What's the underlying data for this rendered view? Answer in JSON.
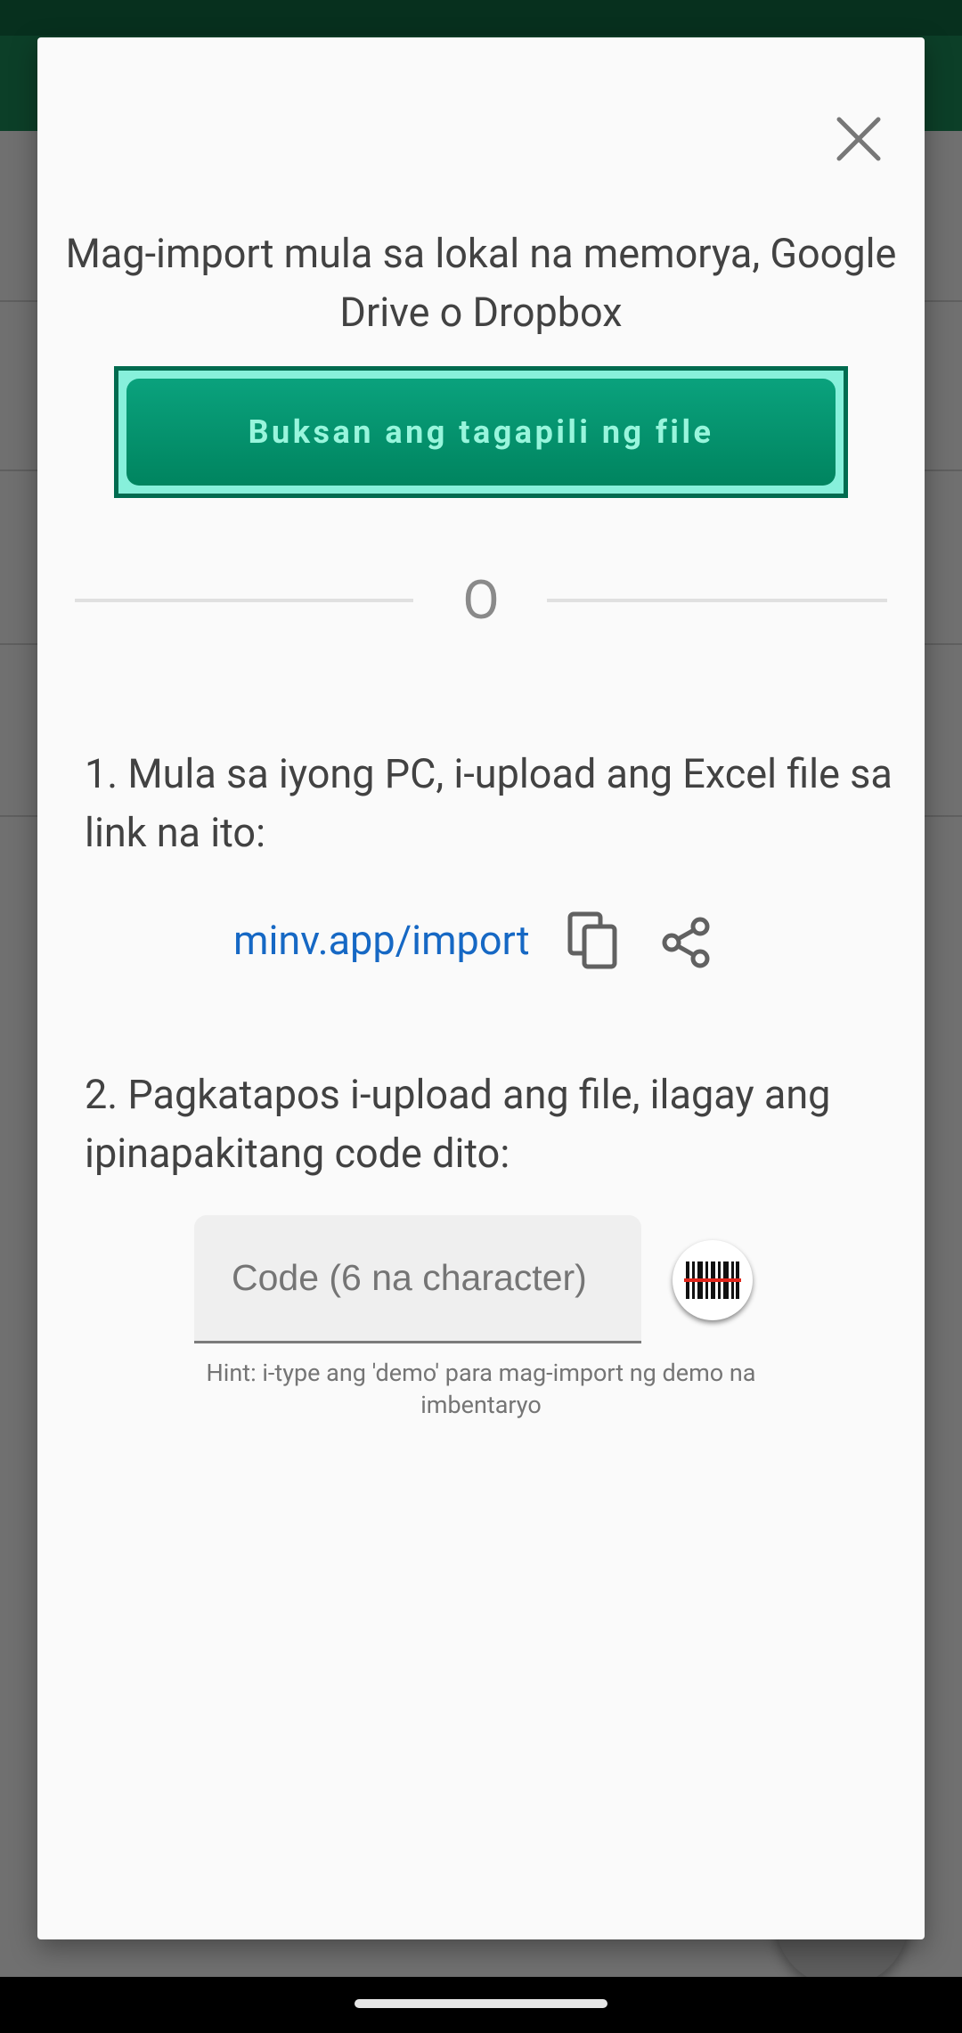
{
  "dialog": {
    "close_icon": "close-icon",
    "title": "Mag-import mula sa lokal na memorya, Google Drive o Dropbox",
    "file_picker_label": "Buksan ang tagapili ng file",
    "divider_text": "O",
    "step1": "1. Mula sa iyong PC, i-upload ang Excel file sa link na ito:",
    "link_text": "minv.app/import",
    "copy_icon": "copy-icon",
    "share_icon": "share-icon",
    "step2": "2. Pagkatapos i-upload ang file, ilagay ang ipinapakitang code dito:",
    "code_placeholder": "Code (6 na character)",
    "code_value": "",
    "scan_icon": "barcode-scan-icon",
    "hint": "Hint: i-type ang 'demo' para mag-import ng demo na imbentaryo"
  },
  "colors": {
    "primary_green": "#00845f",
    "button_text": "#98f5dc",
    "focus_outline": "#87f0db",
    "link": "#1668c4",
    "app_bar": "#0c3f28"
  }
}
